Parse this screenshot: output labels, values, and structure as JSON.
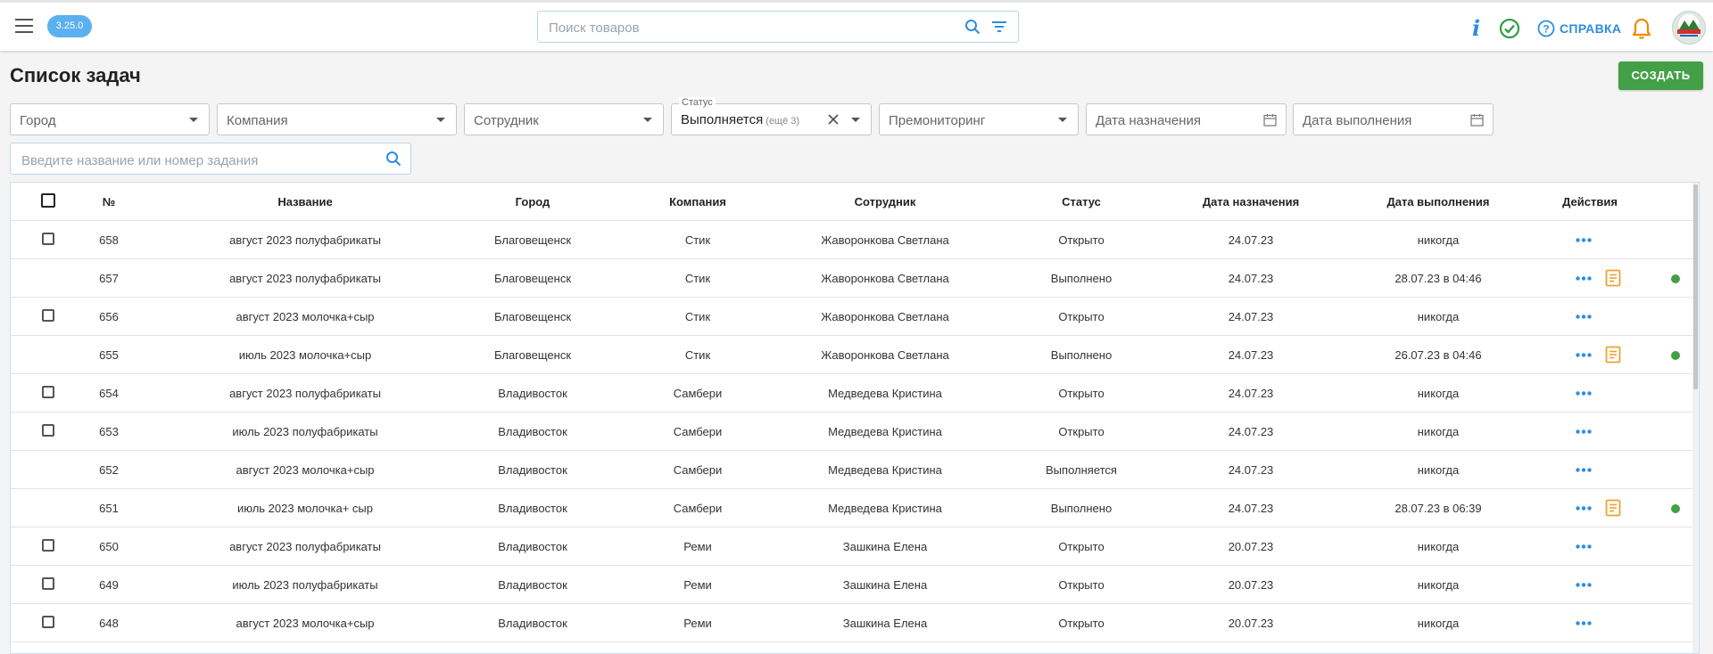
{
  "topbar": {
    "version": "3.25.0",
    "search_placeholder": "Поиск товаров",
    "help_label": "СПРАВКА"
  },
  "page": {
    "title": "Список задач",
    "create_label": "СОЗДАТЬ"
  },
  "filters": {
    "city": "Город",
    "company": "Компания",
    "employee": "Сотрудник",
    "status_legend": "Статус",
    "status_value": "Выполняется",
    "status_more": "(ещё 3)",
    "premonitoring": "Премониторинг",
    "assign_date": "Дата назначения",
    "done_date": "Дата выполнения",
    "task_search_placeholder": "Введите название или номер задания"
  },
  "table": {
    "headers": {
      "num": "№",
      "name": "Название",
      "city": "Город",
      "company": "Компания",
      "employee": "Сотрудник",
      "status": "Статус",
      "assign_date": "Дата назначения",
      "done_date": "Дата выполнения",
      "actions": "Действия"
    },
    "rows": [
      {
        "num": "658",
        "name": "август 2023 полуфабрикаты",
        "city": "Благовещенск",
        "company": "Стик",
        "employee": "Жаворонкова Светлана",
        "status": "Открыто",
        "assign_date": "24.07.23",
        "done_date": "никогда",
        "checkbox": true,
        "report": false,
        "done": false
      },
      {
        "num": "657",
        "name": "август 2023 полуфабрикаты",
        "city": "Благовещенск",
        "company": "Стик",
        "employee": "Жаворонкова Светлана",
        "status": "Выполнено",
        "assign_date": "24.07.23",
        "done_date": "28.07.23 в 04:46",
        "checkbox": false,
        "report": true,
        "done": true
      },
      {
        "num": "656",
        "name": "август 2023 молочка+сыр",
        "city": "Благовещенск",
        "company": "Стик",
        "employee": "Жаворонкова Светлана",
        "status": "Открыто",
        "assign_date": "24.07.23",
        "done_date": "никогда",
        "checkbox": true,
        "report": false,
        "done": false
      },
      {
        "num": "655",
        "name": "июль 2023 молочка+сыр",
        "city": "Благовещенск",
        "company": "Стик",
        "employee": "Жаворонкова Светлана",
        "status": "Выполнено",
        "assign_date": "24.07.23",
        "done_date": "26.07.23 в 04:46",
        "checkbox": false,
        "report": true,
        "done": true
      },
      {
        "num": "654",
        "name": "август 2023 полуфабрикаты",
        "city": "Владивосток",
        "company": "Самбери",
        "employee": "Медведева Кристина",
        "status": "Открыто",
        "assign_date": "24.07.23",
        "done_date": "никогда",
        "checkbox": true,
        "report": false,
        "done": false
      },
      {
        "num": "653",
        "name": "июль 2023 полуфабрикаты",
        "city": "Владивосток",
        "company": "Самбери",
        "employee": "Медведева Кристина",
        "status": "Открыто",
        "assign_date": "24.07.23",
        "done_date": "никогда",
        "checkbox": true,
        "report": false,
        "done": false
      },
      {
        "num": "652",
        "name": "август 2023 молочка+сыр",
        "city": "Владивосток",
        "company": "Самбери",
        "employee": "Медведева Кристина",
        "status": "Выполняется",
        "assign_date": "24.07.23",
        "done_date": "никогда",
        "checkbox": false,
        "report": false,
        "done": false
      },
      {
        "num": "651",
        "name": "июль 2023 молочка+ сыр",
        "city": "Владивосток",
        "company": "Самбери",
        "employee": "Медведева Кристина",
        "status": "Выполнено",
        "assign_date": "24.07.23",
        "done_date": "28.07.23 в 06:39",
        "checkbox": false,
        "report": true,
        "done": true
      },
      {
        "num": "650",
        "name": "август 2023 полуфабрикаты",
        "city": "Владивосток",
        "company": "Реми",
        "employee": "Зашкина Елена",
        "status": "Открыто",
        "assign_date": "20.07.23",
        "done_date": "никогда",
        "checkbox": true,
        "report": false,
        "done": false
      },
      {
        "num": "649",
        "name": "июль 2023 полуфабрикаты",
        "city": "Владивосток",
        "company": "Реми",
        "employee": "Зашкина Елена",
        "status": "Открыто",
        "assign_date": "20.07.23",
        "done_date": "никогда",
        "checkbox": true,
        "report": false,
        "done": false
      },
      {
        "num": "648",
        "name": "август 2023 молочка+сыр",
        "city": "Владивосток",
        "company": "Реми",
        "employee": "Зашкина Елена",
        "status": "Открыто",
        "assign_date": "20.07.23",
        "done_date": "никогда",
        "checkbox": true,
        "report": false,
        "done": false
      }
    ]
  },
  "colors": {
    "accent": "#2d8ddf",
    "create_button": "#43a047",
    "version_badge": "#5bb0f0",
    "report_icon": "#f0a030",
    "done_dot": "#43a047"
  },
  "icons": [
    "menu-icon",
    "search-icon",
    "filter-icon",
    "info-icon",
    "check-circle-icon",
    "help-icon",
    "bell-icon",
    "avatar-logo",
    "calendar-icon",
    "close-icon",
    "more-dots-icon",
    "report-icon"
  ]
}
